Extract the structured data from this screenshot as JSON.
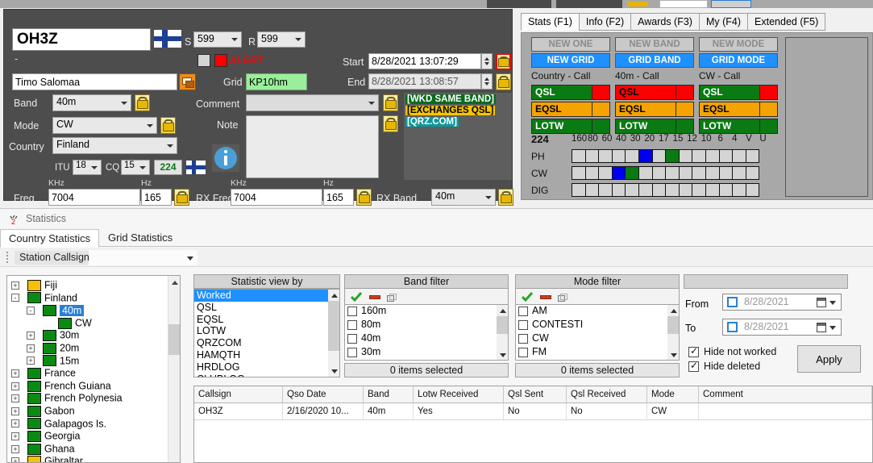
{
  "qso": {
    "callsign": "OH3Z",
    "flag_icon": "finland-flag",
    "s_label": "S",
    "s_value": "599",
    "r_label": "R",
    "r_value": "599",
    "dash": "-",
    "alert_text": "ALERT",
    "name": "Timo Salomaa",
    "grid_label": "Grid",
    "grid_value": "KP10hm",
    "start_label": "Start",
    "start_value": "8/28/2021 13:07:29",
    "end_label": "End",
    "end_value": "8/28/2021 13:08:57",
    "band_label": "Band",
    "band_value": "40m",
    "mode_label": "Mode",
    "mode_value": "CW",
    "country_label": "Country",
    "country_value": "Finland",
    "itu_label": "ITU",
    "itu_value": "18",
    "cq_label": "CQ",
    "cq_value": "15",
    "zone_number": "224",
    "comment_label": "Comment",
    "comment_value": "",
    "note_label": "Note",
    "note_value": "",
    "freq_label": "Freq",
    "freq_khz_unit": "KHz",
    "freq_hz_unit": "Hz",
    "freq_khz": "7004",
    "freq_hz": "165",
    "rx_freq_label": "RX Freq",
    "rx_khz_unit": "KHz",
    "rx_hz_unit": "Hz",
    "rx_khz": "7004",
    "rx_hz": "165",
    "rx_band_label": "RX Band",
    "rx_band_value": "40m",
    "tags": [
      {
        "text": "[WKD SAME BAND]",
        "style": "g"
      },
      {
        "text": "[EXCHANGES QSL]",
        "style": "y"
      },
      {
        "text": "[QRZ.COM]",
        "style": "t"
      }
    ]
  },
  "stats_tabs": [
    {
      "label": "Stats (F1)",
      "active": true
    },
    {
      "label": "Info (F2)",
      "active": false
    },
    {
      "label": "Awards (F3)",
      "active": false
    },
    {
      "label": "My (F4)",
      "active": false
    },
    {
      "label": "Extended (F5)",
      "active": false
    }
  ],
  "stats": {
    "columns": [
      {
        "new_top": "NEW ONE",
        "new_grid": "NEW GRID",
        "caption": "Country - Call",
        "qsl_label": "QSL",
        "qsl_color": "bg-green",
        "qsl_sq_color": "bg-red",
        "eqsl_label": "EQSL",
        "eqsl_color": "bg-orange",
        "eqsl_sq_color": "bg-orange",
        "lotw_label": "LOTW",
        "lotw_color": "bg-green",
        "lotw_sq_color": "bg-green"
      },
      {
        "new_top": "NEW BAND",
        "new_grid": "GRID BAND",
        "caption": "40m - Call",
        "qsl_label": "QSL",
        "qsl_color": "bg-red",
        "qsl_sq_color": "bg-red",
        "eqsl_label": "EQSL",
        "eqsl_color": "bg-orange",
        "eqsl_sq_color": "bg-orange",
        "lotw_label": "LOTW",
        "lotw_color": "bg-green",
        "lotw_sq_color": "bg-green"
      },
      {
        "new_top": "NEW MODE",
        "new_grid": "GRID MODE",
        "caption": "CW - Call",
        "qsl_label": "QSL",
        "qsl_color": "bg-green",
        "qsl_sq_color": "bg-red",
        "eqsl_label": "EQSL",
        "eqsl_color": "bg-orange",
        "eqsl_sq_color": "bg-orange",
        "lotw_label": "LOTW",
        "lotw_color": "bg-green",
        "lotw_sq_color": "bg-green"
      }
    ],
    "matrix": {
      "count": "224",
      "bands": [
        "160",
        "80",
        "60",
        "40",
        "30",
        "20",
        "17",
        "15",
        "12",
        "10",
        "6",
        "4",
        "V",
        "U"
      ],
      "rows": [
        {
          "label": "PH",
          "cells": [
            "",
            "",
            "",
            "",
            "",
            "blue",
            "",
            "green",
            "",
            "",
            "",
            "",
            "",
            ""
          ]
        },
        {
          "label": "CW",
          "cells": [
            "",
            "",
            "",
            "blue",
            "green",
            "",
            "",
            "",
            "",
            "",
            "",
            "",
            "",
            ""
          ]
        },
        {
          "label": "DIG",
          "cells": [
            "",
            "",
            "",
            "",
            "",
            "",
            "",
            "",
            "",
            "",
            "",
            "",
            "",
            ""
          ]
        }
      ]
    }
  },
  "statistics_window": {
    "title": "Statistics",
    "title_icon": "statistics-icon",
    "tabs": [
      {
        "label": "Country Statistics",
        "active": true
      },
      {
        "label": "Grid Statistics",
        "active": false
      }
    ],
    "station_callsign_label": "Station Callsign",
    "station_callsign_value": ""
  },
  "tree": {
    "nodes": [
      {
        "label": "Fiji",
        "indent": 0,
        "expander": "+",
        "swatch": "yellow",
        "selected": false
      },
      {
        "label": "Finland",
        "indent": 0,
        "expander": "-",
        "swatch": "green",
        "selected": false
      },
      {
        "label": "40m",
        "indent": 1,
        "expander": "-",
        "swatch": "green",
        "selected": true
      },
      {
        "label": "CW",
        "indent": 2,
        "expander": "",
        "swatch": "green",
        "selected": false
      },
      {
        "label": "30m",
        "indent": 1,
        "expander": "+",
        "swatch": "green",
        "selected": false
      },
      {
        "label": "20m",
        "indent": 1,
        "expander": "+",
        "swatch": "green",
        "selected": false
      },
      {
        "label": "15m",
        "indent": 1,
        "expander": "+",
        "swatch": "green",
        "selected": false
      },
      {
        "label": "France",
        "indent": 0,
        "expander": "+",
        "swatch": "green",
        "selected": false
      },
      {
        "label": "French Guiana",
        "indent": 0,
        "expander": "+",
        "swatch": "green",
        "selected": false
      },
      {
        "label": "French Polynesia",
        "indent": 0,
        "expander": "+",
        "swatch": "green",
        "selected": false
      },
      {
        "label": "Gabon",
        "indent": 0,
        "expander": "+",
        "swatch": "green",
        "selected": false
      },
      {
        "label": "Galapagos Is.",
        "indent": 0,
        "expander": "+",
        "swatch": "green",
        "selected": false
      },
      {
        "label": "Georgia",
        "indent": 0,
        "expander": "+",
        "swatch": "green",
        "selected": false
      },
      {
        "label": "Ghana",
        "indent": 0,
        "expander": "+",
        "swatch": "green",
        "selected": false
      },
      {
        "label": "Gibraltar",
        "indent": 0,
        "expander": "+",
        "swatch": "yellow",
        "selected": false
      }
    ]
  },
  "statistic_view_by": {
    "header": "Statistic view by",
    "items": [
      {
        "label": "Worked",
        "selected": true
      },
      {
        "label": "QSL",
        "selected": false
      },
      {
        "label": "EQSL",
        "selected": false
      },
      {
        "label": "LOTW",
        "selected": false
      },
      {
        "label": "QRZCOM",
        "selected": false
      },
      {
        "label": "HAMQTH",
        "selected": false
      },
      {
        "label": "HRDLOG",
        "selected": false
      },
      {
        "label": "CLUBLOG",
        "selected": false
      }
    ]
  },
  "band_filter": {
    "header": "Band filter",
    "items": [
      "160m",
      "80m",
      "40m",
      "30m"
    ],
    "footer": "0 items selected"
  },
  "mode_filter": {
    "header": "Mode filter",
    "items": [
      "AM",
      "CONTESTI",
      "CW",
      "FM"
    ],
    "footer": "0 items selected"
  },
  "date_filter": {
    "from_label": "From",
    "from_value": "8/28/2021",
    "to_label": "To",
    "to_value": "8/28/2021",
    "hide_not_worked": "Hide not worked",
    "hide_deleted": "Hide deleted",
    "apply_label": "Apply"
  },
  "qso_grid": {
    "columns": [
      "Callsign",
      "Qso Date",
      "Band",
      "Lotw Received",
      "Qsl Sent",
      "Qsl Received",
      "Mode",
      "Comment"
    ],
    "rows": [
      [
        "OH3Z",
        "2/16/2020 10...",
        "40m",
        "Yes",
        "No",
        "No",
        "CW",
        ""
      ]
    ]
  }
}
